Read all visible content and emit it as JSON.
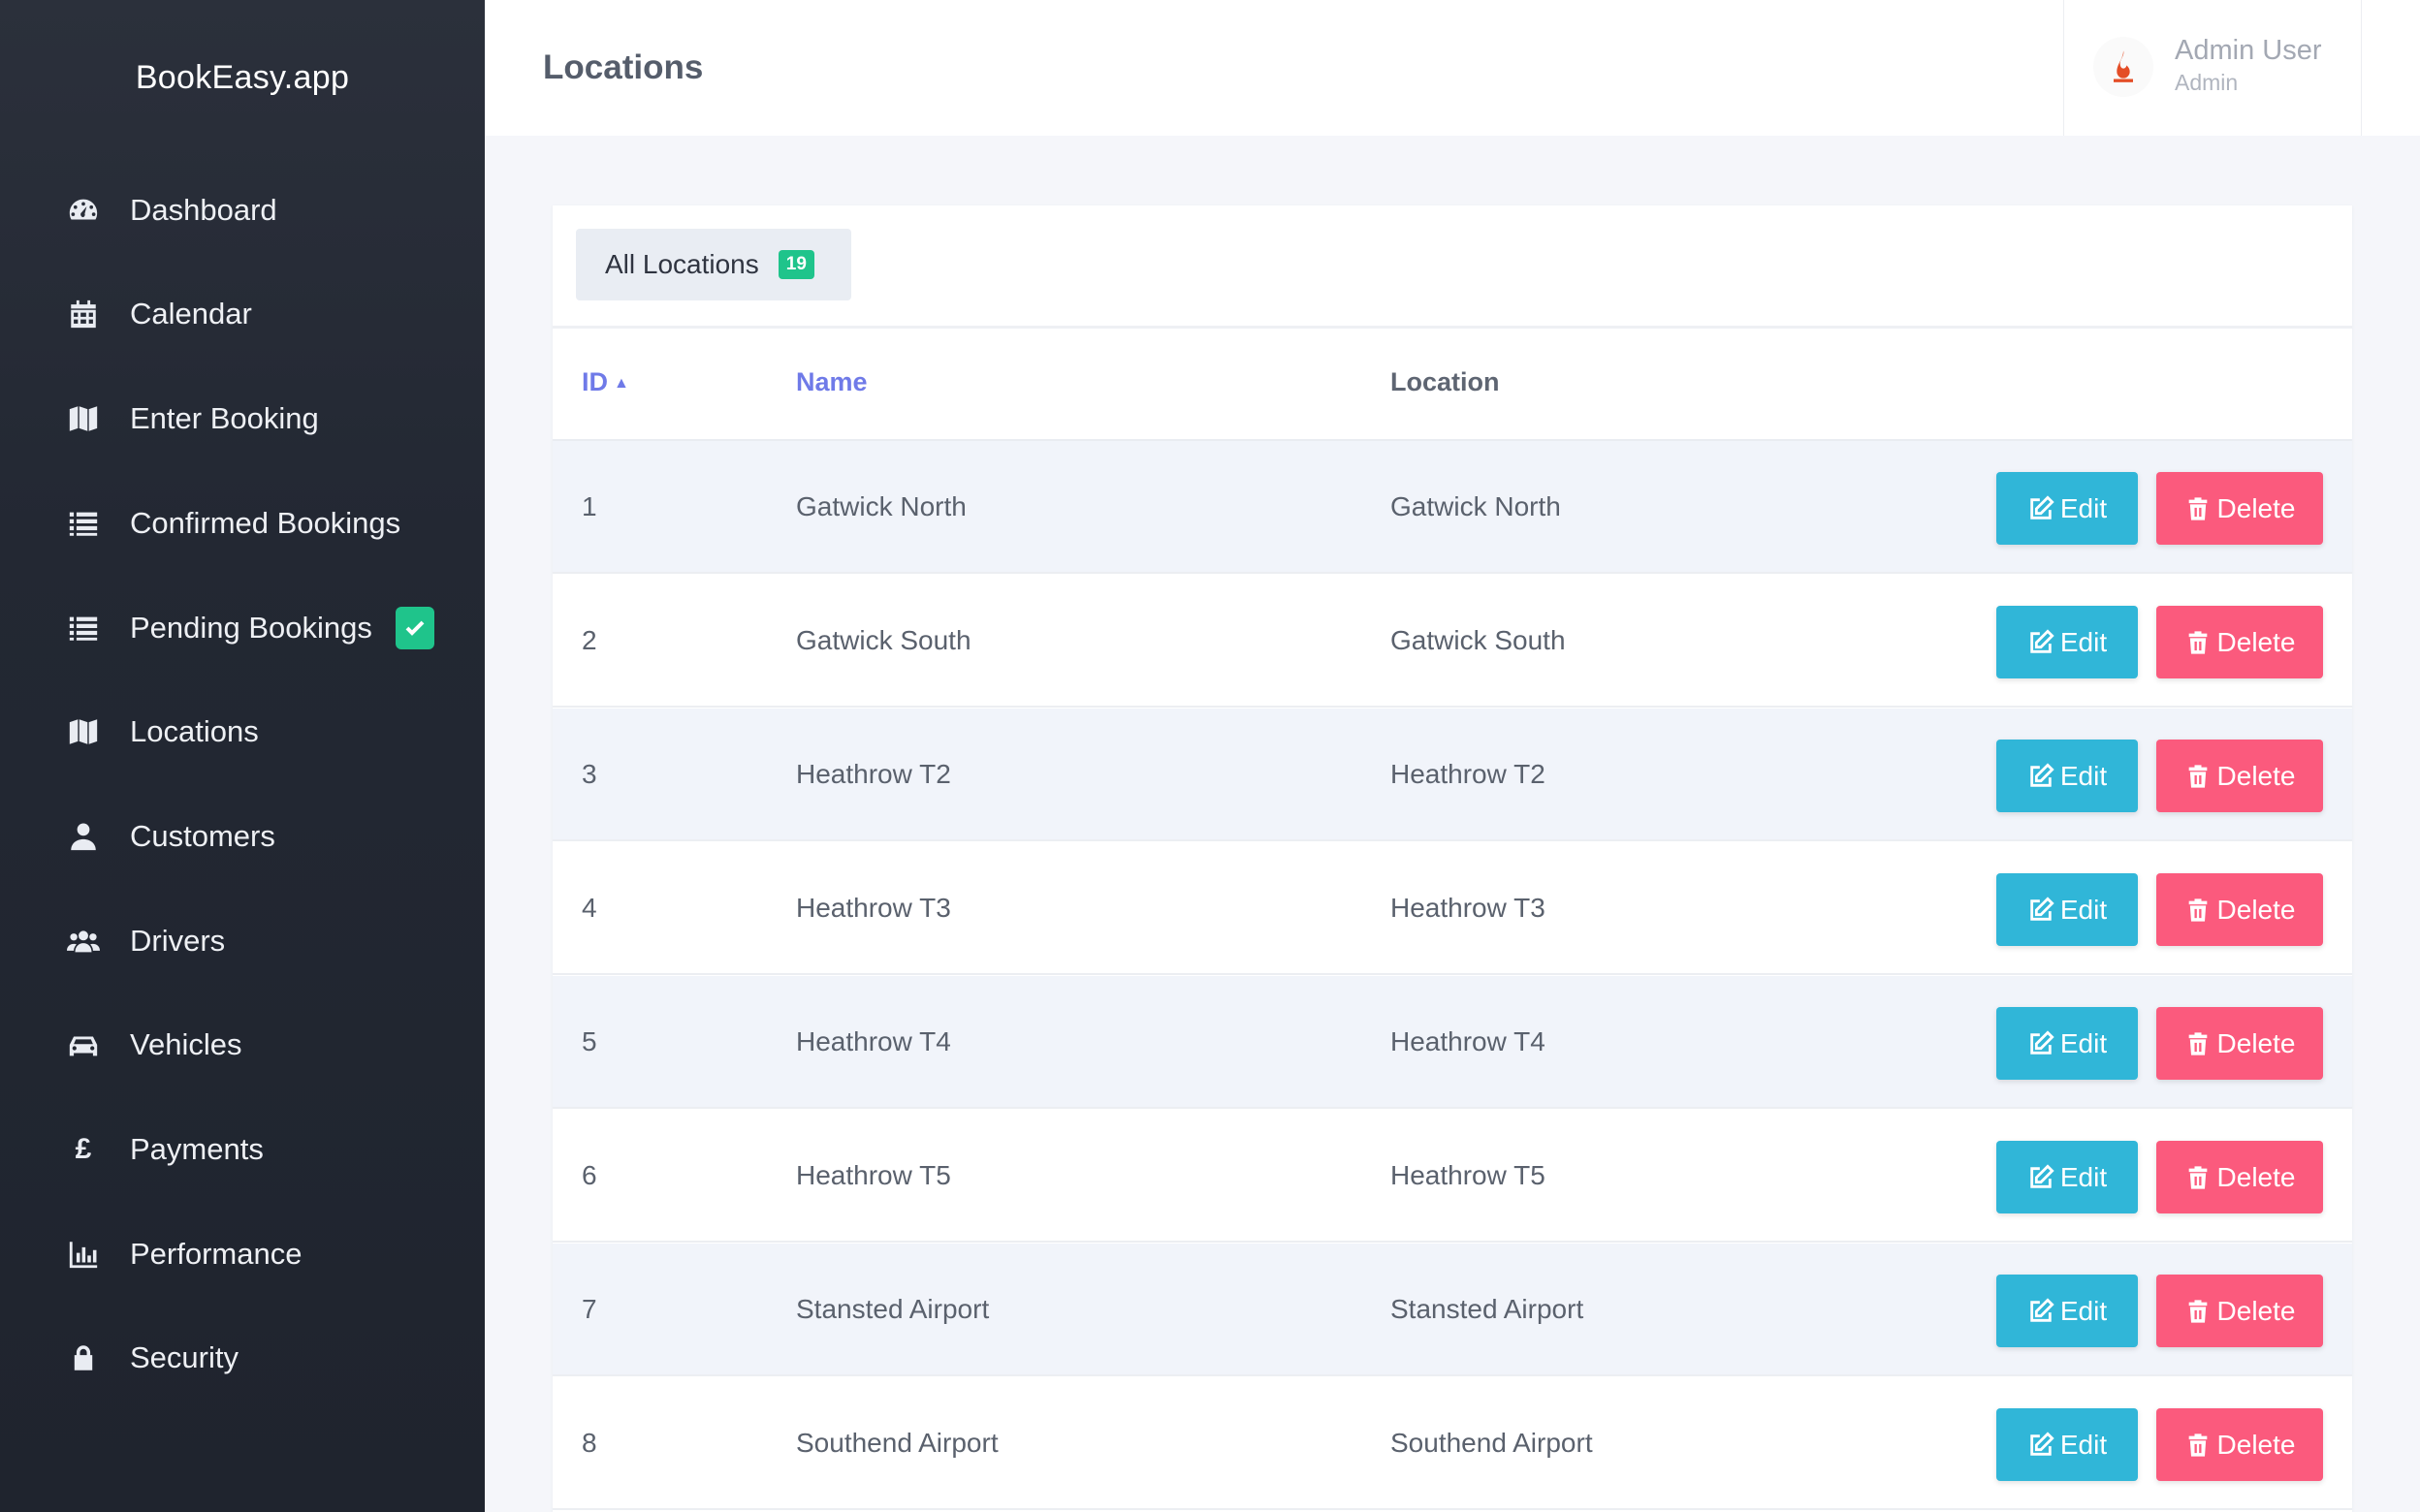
{
  "app": {
    "brand": "BookEasy.app"
  },
  "sidebar": {
    "items": [
      {
        "label": "Dashboard",
        "icon": "dashboard-gauge-icon"
      },
      {
        "label": "Calendar",
        "icon": "calendar-icon"
      },
      {
        "label": "Enter Booking",
        "icon": "map-icon"
      },
      {
        "label": "Confirmed Bookings",
        "icon": "list-icon"
      },
      {
        "label": "Pending Bookings",
        "icon": "list-icon",
        "badge_icon": "check-icon"
      },
      {
        "label": "Locations",
        "icon": "map-icon"
      },
      {
        "label": "Customers",
        "icon": "user-icon"
      },
      {
        "label": "Drivers",
        "icon": "users-icon"
      },
      {
        "label": "Vehicles",
        "icon": "car-icon"
      },
      {
        "label": "Payments",
        "icon": "pound-icon",
        "glyph": "£"
      },
      {
        "label": "Performance",
        "icon": "bar-chart-icon"
      },
      {
        "label": "Security",
        "icon": "lock-icon"
      }
    ]
  },
  "header": {
    "title": "Locations",
    "user": {
      "name": "Admin User",
      "role": "Admin"
    }
  },
  "tabs": [
    {
      "label": "All Locations",
      "count": "19"
    }
  ],
  "table": {
    "columns": {
      "id": "ID",
      "name": "Name",
      "location": "Location"
    },
    "sort": {
      "column": "ID",
      "direction": "asc"
    },
    "rows": [
      {
        "id": "1",
        "name": "Gatwick North",
        "location": "Gatwick North"
      },
      {
        "id": "2",
        "name": "Gatwick South",
        "location": "Gatwick South"
      },
      {
        "id": "3",
        "name": "Heathrow T2",
        "location": "Heathrow T2"
      },
      {
        "id": "4",
        "name": "Heathrow T3",
        "location": "Heathrow T3"
      },
      {
        "id": "5",
        "name": "Heathrow T4",
        "location": "Heathrow T4"
      },
      {
        "id": "6",
        "name": "Heathrow T5",
        "location": "Heathrow T5"
      },
      {
        "id": "7",
        "name": "Stansted Airport",
        "location": "Stansted Airport"
      },
      {
        "id": "8",
        "name": "Southend Airport",
        "location": "Southend Airport"
      }
    ],
    "actions": {
      "edit": "Edit",
      "delete": "Delete"
    }
  },
  "colors": {
    "sidebar_bg": "#232833",
    "accent_link": "#6f7ae8",
    "badge_green": "#1fc48b",
    "edit_button": "#30b6d8",
    "delete_button": "#fb5a7d"
  }
}
